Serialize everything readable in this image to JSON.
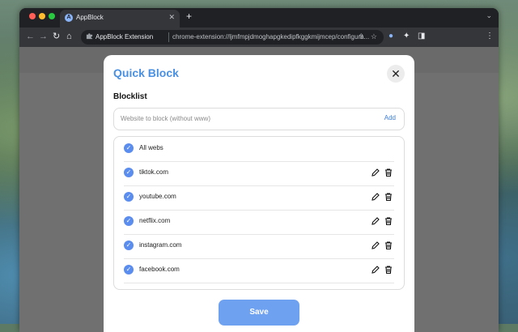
{
  "browser": {
    "tab": {
      "title": "AppBlock",
      "close": "✕",
      "favicon": "A"
    },
    "new_tab": "+",
    "tab_menu": "⌄",
    "toolbar": {
      "back": "←",
      "forward": "→",
      "reload": "↻",
      "home": "⌂",
      "site_label": "AppBlock Extension",
      "url": "chrome-extension://ljmfmpjdmoghapgkedipfkggkmijmcep/configura...",
      "share": "⇪",
      "bookmark": "☆",
      "profile": "●",
      "extensions": "✦",
      "sidepanel": "◨",
      "menu": "⋮"
    }
  },
  "dialog": {
    "title": "Quick Block",
    "close": "✕",
    "section_label": "Blocklist",
    "input_placeholder": "Website to block (without www)",
    "add_label": "Add",
    "items": [
      {
        "label": "All webs",
        "checked": true,
        "editable": false
      },
      {
        "label": "tiktok.com",
        "checked": true,
        "editable": true
      },
      {
        "label": "youtube.com",
        "checked": true,
        "editable": true
      },
      {
        "label": "netflix.com",
        "checked": true,
        "editable": true
      },
      {
        "label": "instagram.com",
        "checked": true,
        "editable": true
      },
      {
        "label": "facebook.com",
        "checked": true,
        "editable": true
      }
    ],
    "check_glyph": "✓",
    "save_label": "Save"
  },
  "colors": {
    "accent": "#4a90e2",
    "check": "#5b8def",
    "save_button": "#6fa1f1"
  }
}
